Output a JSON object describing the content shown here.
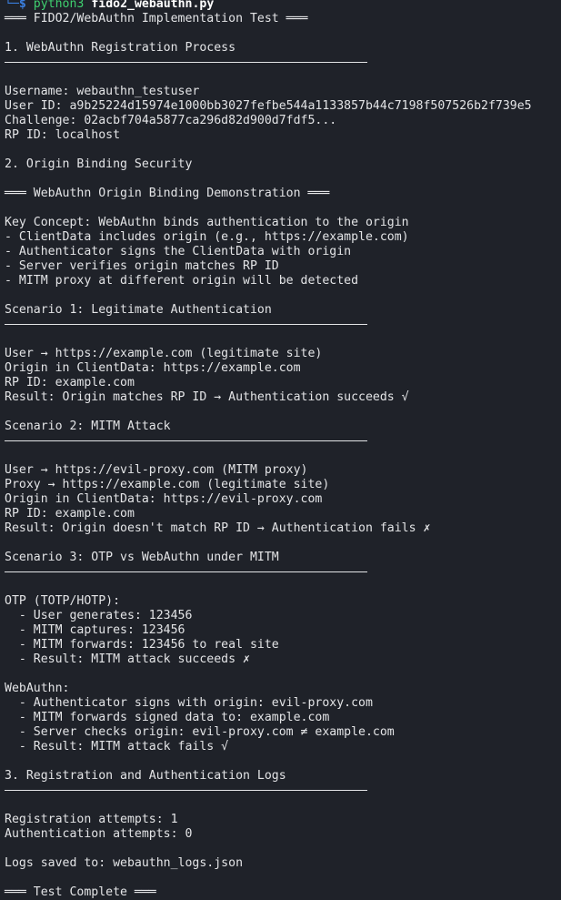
{
  "prompt": {
    "corner": "└─",
    "symbol": "$",
    "command": "python3",
    "argument": "fido2_webauthn.py"
  },
  "lines": [
    "═══ FIDO2/WebAuthn Implementation Test ═══",
    "",
    "1. WebAuthn Registration Process",
    "---",
    "",
    "Username: webauthn_testuser",
    "User ID: a9b25224d15974e1000bb3027fefbe544a1133857b44c7198f507526b2f739e5",
    "Challenge: 02acbf704a5877ca296d82d900d7fdf5...",
    "RP ID: localhost",
    "",
    "2. Origin Binding Security",
    "",
    "═══ WebAuthn Origin Binding Demonstration ═══",
    "",
    "Key Concept: WebAuthn binds authentication to the origin",
    "- ClientData includes origin (e.g., https://example.com)",
    "- Authenticator signs the ClientData with origin",
    "- Server verifies origin matches RP ID",
    "- MITM proxy at different origin will be detected",
    "",
    "Scenario 1: Legitimate Authentication",
    "---",
    "",
    "User → https://example.com (legitimate site)",
    "Origin in ClientData: https://example.com",
    "RP ID: example.com",
    "Result: Origin matches RP ID → Authentication succeeds √",
    "",
    "Scenario 2: MITM Attack",
    "---",
    "",
    "User → https://evil-proxy.com (MITM proxy)",
    "Proxy → https://example.com (legitimate site)",
    "Origin in ClientData: https://evil-proxy.com",
    "RP ID: example.com",
    "Result: Origin doesn't match RP ID → Authentication fails ✗",
    "",
    "Scenario 3: OTP vs WebAuthn under MITM",
    "---",
    "",
    "OTP (TOTP/HOTP):",
    "  - User generates: 123456",
    "  - MITM captures: 123456",
    "  - MITM forwards: 123456 to real site",
    "  - Result: MITM attack succeeds ✗",
    "",
    "WebAuthn:",
    "  - Authenticator signs with origin: evil-proxy.com",
    "  - MITM forwards signed data to: example.com",
    "  - Server checks origin: evil-proxy.com ≠ example.com",
    "  - Result: MITM attack fails √",
    "",
    "3. Registration and Authentication Logs",
    "---",
    "",
    "Registration attempts: 1",
    "Authentication attempts: 0",
    "",
    "Logs saved to: webauthn_logs.json",
    "",
    "═══ Test Complete ═══"
  ]
}
